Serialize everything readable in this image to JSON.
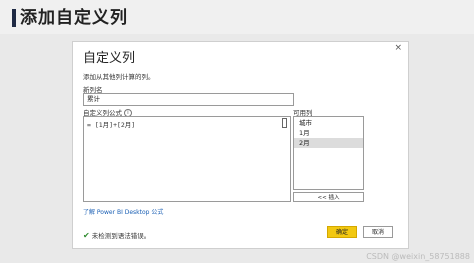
{
  "page": {
    "title": "添加自定义列"
  },
  "dialog": {
    "title": "自定义列",
    "subtitle": "添加从其他列计算的列。",
    "new_column_label": "新列名",
    "new_column_value": "累计",
    "formula_label": "自定义列公式",
    "info_icon": "i",
    "formula_value": "= [1月]+[2月]",
    "available_columns_label": "可用列",
    "available_columns": [
      {
        "label": "城市",
        "selected": false
      },
      {
        "label": "1月",
        "selected": false
      },
      {
        "label": "2月",
        "selected": true
      }
    ],
    "insert_label": "<< 插入",
    "learn_link": "了解 Power BI Desktop 公式",
    "status_text": "未检测到语法错误。",
    "ok_label": "确定",
    "cancel_label": "取消",
    "close_glyph": "×"
  },
  "watermark": "CSDN @weixin_58751888",
  "colors": {
    "accent": "#f2c811",
    "link": "#1a5fb4",
    "success": "#2e8b2e"
  }
}
